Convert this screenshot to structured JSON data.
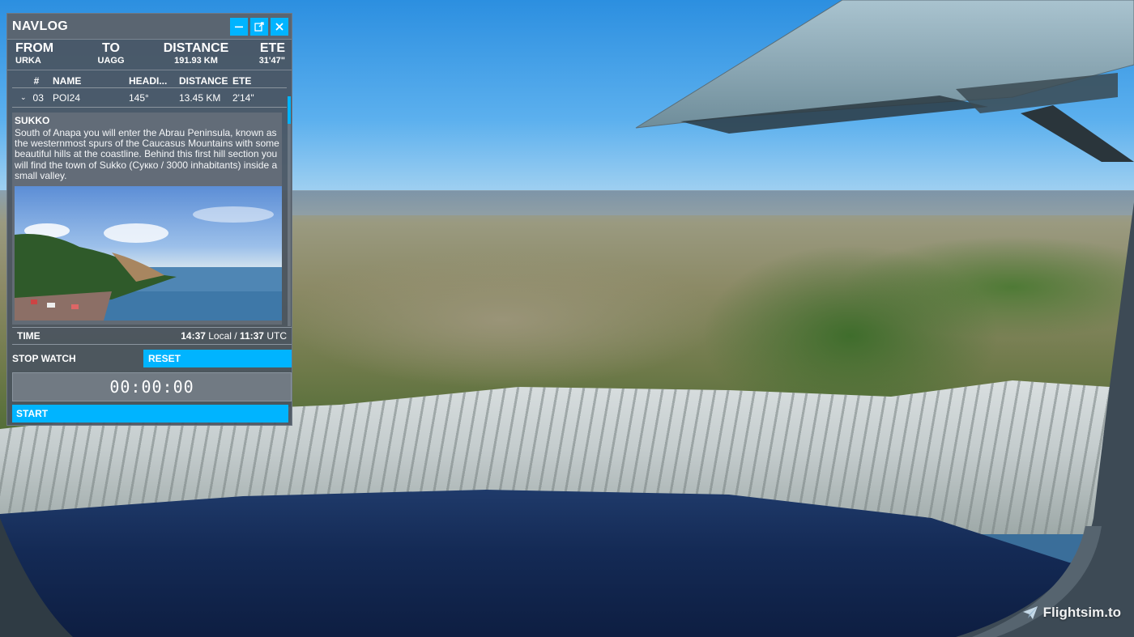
{
  "navlog": {
    "title": "NAVLOG",
    "window_buttons": [
      "minimize-icon",
      "undock-icon",
      "close-icon"
    ],
    "route": {
      "from_label": "FROM",
      "from_value": "URKA",
      "to_label": "TO",
      "to_value": "UAGG",
      "distance_label": "DISTANCE",
      "distance_value": "191.93 KM",
      "ete_label": "ETE",
      "ete_value": "31'47\""
    },
    "waypoint_columns": [
      "#",
      "NAME",
      "HEADI...",
      "DISTANCE",
      "ETE"
    ],
    "waypoint": {
      "number": "03",
      "name": "POI24",
      "heading": "145°",
      "distance": "13.45 KM",
      "ete": "2'14\""
    },
    "detail": {
      "title": "SUKKO",
      "text": "South of Anapa you will enter the Abrau Peninsula, known as the westernmost spurs of the Caucasus Mountains with some beautiful hills at the coastline. Behind this first hill section you will find the town of Sukko (Сукко / 3000 inhabitants) inside a small valley."
    },
    "time": {
      "label": "TIME",
      "local_value": "14:37",
      "local_label": "Local /",
      "utc_value": "11:37",
      "utc_label": "UTC"
    },
    "stopwatch": {
      "label": "STOP WATCH",
      "reset_label": "RESET",
      "display": "00:00:00",
      "start_label": "START"
    }
  },
  "watermark": {
    "text": "Flightsim.to",
    "icon": "paper-plane-icon"
  },
  "colors": {
    "accent": "#00b4ff",
    "panel": "#4a5460"
  }
}
